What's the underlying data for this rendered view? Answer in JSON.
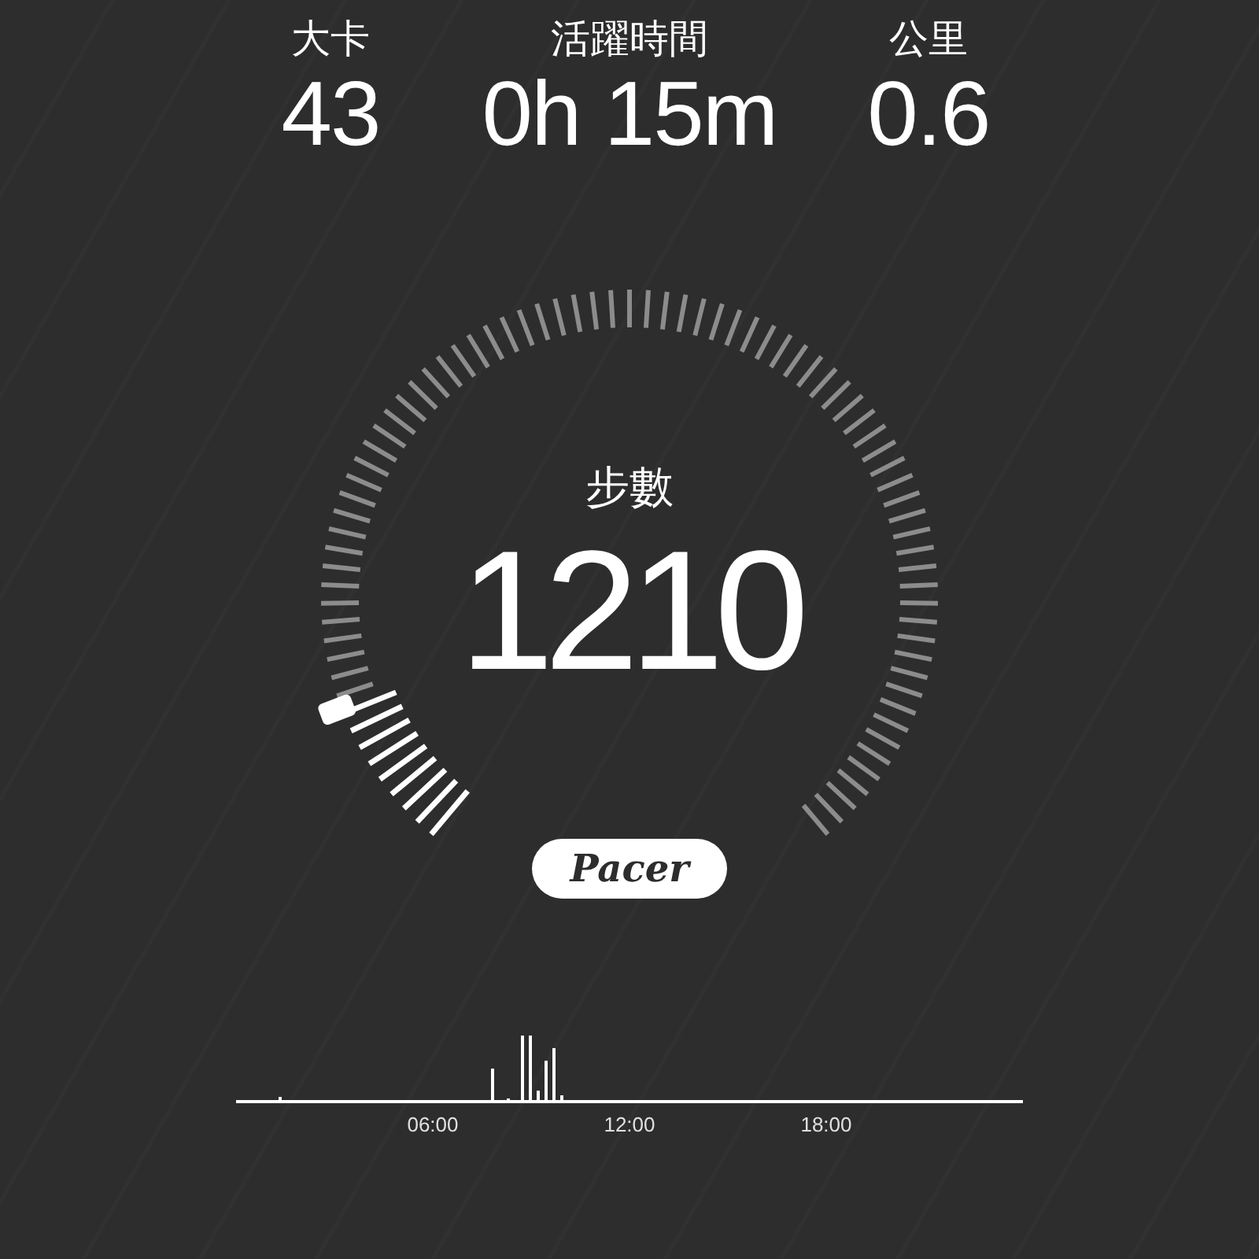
{
  "stats": [
    {
      "label": "大卡",
      "value": "43"
    },
    {
      "label": "活躍時間",
      "value": "0h 15m"
    },
    {
      "label": "公里",
      "value": "0.6"
    }
  ],
  "gauge": {
    "label": "步數",
    "value": "1210"
  },
  "logo": {
    "text": "Pacer"
  },
  "activity_chart": {
    "x_labels": [
      "06:00",
      "12:00",
      "18:00"
    ]
  }
}
